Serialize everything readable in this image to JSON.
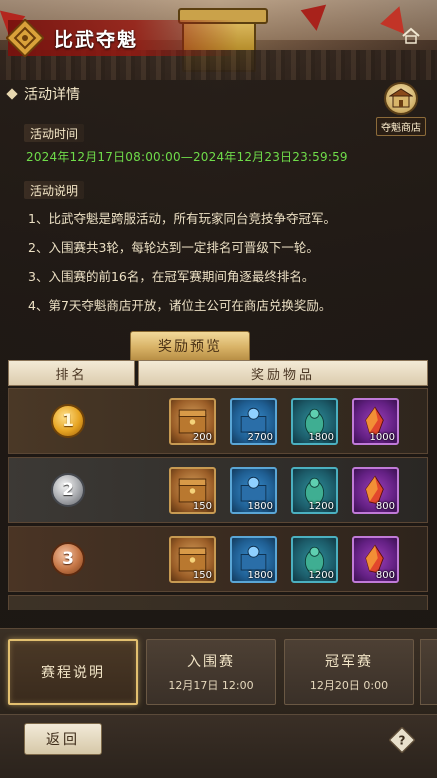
{
  "header": {
    "title": "比武夺魁",
    "home_icon": "home-icon",
    "emblem_icon": "knot-emblem-icon"
  },
  "details": {
    "section_title": "活动详情",
    "shop_label": "夺魁商店",
    "time_tag": "活动时间",
    "time_range": "2024年12月17日08:00:00—2024年12月23日23:59:59",
    "desc_tag": "活动说明",
    "rules": [
      "1、比武夺魁是跨服活动，所有玩家同台竞技争夺冠军。",
      "2、入围赛共3轮，每轮达到一定排名可晋级下一轮。",
      "3、入围赛的前16名，在冠军赛期间角逐最终排名。",
      "4、第7天夺魁商店开放，诸位主公可在商店兑换奖励。"
    ]
  },
  "rewards": {
    "tab_label": "奖励预览",
    "col_rank": "排名",
    "col_items": "奖励物品",
    "rows": [
      {
        "rank": "1",
        "items": [
          {
            "icon": "treasure-chest-icon",
            "qty": "200"
          },
          {
            "icon": "blue-crate-icon",
            "qty": "2700"
          },
          {
            "icon": "jade-statue-icon",
            "qty": "1800"
          },
          {
            "icon": "red-crystal-icon",
            "qty": "1000"
          }
        ]
      },
      {
        "rank": "2",
        "items": [
          {
            "icon": "treasure-chest-icon",
            "qty": "150"
          },
          {
            "icon": "blue-crate-icon",
            "qty": "1800"
          },
          {
            "icon": "jade-statue-icon",
            "qty": "1200"
          },
          {
            "icon": "red-crystal-icon",
            "qty": "800"
          }
        ]
      },
      {
        "rank": "3",
        "items": [
          {
            "icon": "treasure-chest-icon",
            "qty": "150"
          },
          {
            "icon": "blue-crate-icon",
            "qty": "1800"
          },
          {
            "icon": "jade-statue-icon",
            "qty": "1200"
          },
          {
            "icon": "red-crystal-icon",
            "qty": "800"
          }
        ]
      }
    ]
  },
  "stages": [
    {
      "title": "赛程说明",
      "date": ""
    },
    {
      "title": "入围赛",
      "date": "12月17日 12:00"
    },
    {
      "title": "冠军赛",
      "date": "12月20日 0:00"
    }
  ],
  "footer": {
    "back_label": "返回",
    "help_icon": "help-icon"
  },
  "colors": {
    "accent_gold": "#e3c070",
    "time_green": "#6fdc4a",
    "banner_red": "#96201a"
  }
}
